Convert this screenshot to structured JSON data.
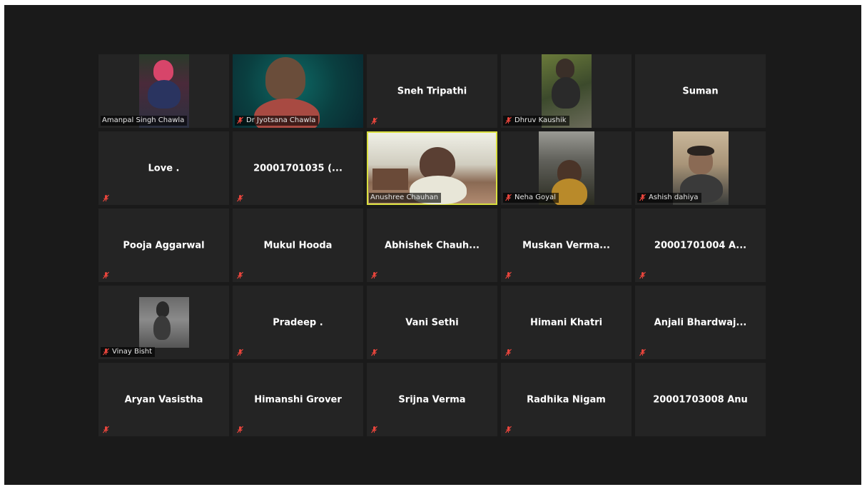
{
  "participants": [
    {
      "name": "Amanpal Singh Chawla",
      "display": "",
      "video": true,
      "muted": false
    },
    {
      "name": "Dr Jyotsana Chawla",
      "display": "",
      "video": true,
      "muted": true
    },
    {
      "name": "",
      "display": "Sneh Tripathi",
      "video": false,
      "muted": true
    },
    {
      "name": "Dhruv Kaushik",
      "display": "",
      "video": true,
      "muted": true
    },
    {
      "name": "",
      "display": "Suman",
      "video": false,
      "muted": false
    },
    {
      "name": "",
      "display": "Love .",
      "video": false,
      "muted": true
    },
    {
      "name": "",
      "display": "20001701035 (...",
      "video": false,
      "muted": true
    },
    {
      "name": "Anushree Chauhan",
      "display": "",
      "video": true,
      "muted": false,
      "active_speaker": true
    },
    {
      "name": "Neha Goyal",
      "display": "",
      "video": true,
      "muted": true
    },
    {
      "name": "Ashish dahiya",
      "display": "",
      "video": true,
      "muted": true
    },
    {
      "name": "",
      "display": "Pooja Aggarwal",
      "video": false,
      "muted": true
    },
    {
      "name": "",
      "display": "Mukul Hooda",
      "video": false,
      "muted": true
    },
    {
      "name": "",
      "display": "Abhishek  Chauh...",
      "video": false,
      "muted": true
    },
    {
      "name": "",
      "display": "Muskan  Verma...",
      "video": false,
      "muted": true
    },
    {
      "name": "",
      "display": "20001701004 A...",
      "video": false,
      "muted": true
    },
    {
      "name": "Vinay Bisht",
      "display": "",
      "video": true,
      "muted": true
    },
    {
      "name": "",
      "display": "Pradeep .",
      "video": false,
      "muted": true
    },
    {
      "name": "",
      "display": "Vani Sethi",
      "video": false,
      "muted": true
    },
    {
      "name": "",
      "display": "Himani Khatri",
      "video": false,
      "muted": true
    },
    {
      "name": "",
      "display": "Anjali  Bhardwaj...",
      "video": false,
      "muted": true
    },
    {
      "name": "",
      "display": "Aryan Vasistha",
      "video": false,
      "muted": true
    },
    {
      "name": "",
      "display": "Himanshi Grover",
      "video": false,
      "muted": true
    },
    {
      "name": "",
      "display": "Srijna Verma",
      "video": false,
      "muted": true
    },
    {
      "name": "",
      "display": "Radhika Nigam",
      "video": false,
      "muted": true
    },
    {
      "name": "",
      "display": "20001703008 Anu",
      "video": false,
      "muted": false
    }
  ],
  "colors": {
    "background": "#1a1a1a",
    "tile": "#242424",
    "active_border": "#d9df3f",
    "muted_icon": "#e8453c"
  },
  "icons": {
    "muted": "muted-mic-icon"
  }
}
